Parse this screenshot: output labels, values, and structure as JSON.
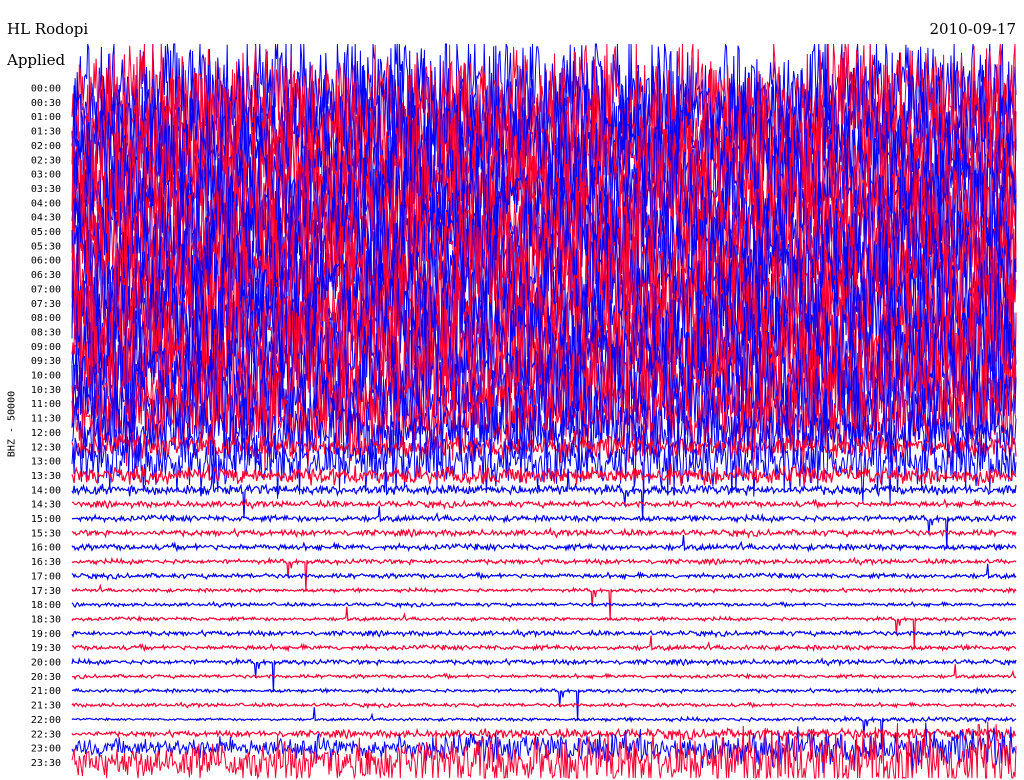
{
  "header": {
    "station": "HL Rodopi",
    "filter": "Applied",
    "date": "2010-09-17"
  },
  "channel_label": "BHZ - 50000",
  "colors": {
    "odd_trace": "#0000ff",
    "even_trace": "#ff0033",
    "background": "#ffffff"
  },
  "chart_data": {
    "type": "line",
    "title": "HL Rodopi",
    "subtitle": "2010-09-17",
    "ylabel": "BHZ - 50000",
    "trace_minutes": 30,
    "row_labels": [
      "00:00",
      "00:30",
      "01:00",
      "01:30",
      "02:00",
      "02:30",
      "03:00",
      "03:30",
      "04:00",
      "04:30",
      "05:00",
      "05:30",
      "06:00",
      "06:30",
      "07:00",
      "07:30",
      "08:00",
      "08:30",
      "09:00",
      "09:30",
      "10:00",
      "10:30",
      "11:00",
      "11:30",
      "12:00",
      "12:30",
      "13:00",
      "13:30",
      "14:00",
      "14:30",
      "15:00",
      "15:30",
      "16:00",
      "16:30",
      "17:00",
      "17:30",
      "18:00",
      "18:30",
      "19:00",
      "19:30",
      "20:00",
      "20:30",
      "21:00",
      "21:30",
      "22:00",
      "22:30",
      "23:00",
      "23:30"
    ],
    "series": [
      {
        "name": "blue",
        "color": "#0000ff",
        "rows": "even-index (00:00, 01:00, ...)"
      },
      {
        "name": "red",
        "color": "#ff0033",
        "rows": "odd-index (00:30, 01:30, ...)"
      }
    ],
    "relative_noise_level": [
      1.0,
      1.0,
      1.0,
      1.0,
      1.0,
      1.0,
      1.0,
      1.0,
      1.0,
      1.0,
      1.0,
      1.0,
      1.0,
      1.0,
      1.0,
      1.0,
      1.0,
      1.0,
      1.0,
      1.0,
      0.95,
      0.9,
      0.8,
      0.7,
      0.55,
      0.2,
      0.5,
      0.15,
      0.08,
      0.05,
      0.05,
      0.05,
      0.05,
      0.04,
      0.04,
      0.03,
      0.03,
      0.03,
      0.04,
      0.04,
      0.04,
      0.03,
      0.03,
      0.03,
      0.04,
      0.1,
      0.35,
      0.7
    ]
  }
}
